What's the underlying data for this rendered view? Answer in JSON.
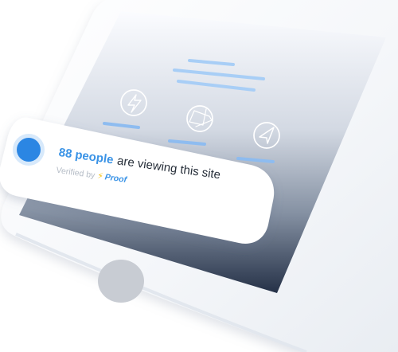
{
  "notification": {
    "count_text": "88 people",
    "message_text": "are viewing this site",
    "verified_label": "Verified by",
    "brand_name": "Proof",
    "bolt_glyph": "⚡"
  },
  "icons": {
    "lightning": "lightning-icon",
    "aperture": "camera-aperture-icon",
    "navigation": "navigation-arrow-icon",
    "home_button": "home-button"
  },
  "colors": {
    "accent_blue": "#3a93e6",
    "status_dot": "#2b86e3",
    "screen_dark": "#253147",
    "screen_light": "#f5f7fb",
    "phone_body": "#f8f9fb",
    "home_button": "#c8ccd3",
    "bolt_yellow": "#f5c319"
  }
}
